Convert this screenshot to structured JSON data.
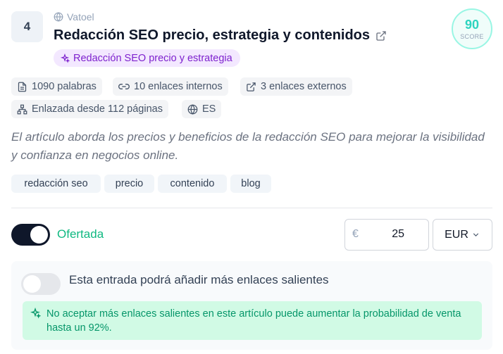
{
  "item": {
    "rank": "4",
    "site": "Vatoel",
    "title": "Redacción SEO precio, estrategia y contenidos",
    "keyword": "Redacción SEO precio y estrategia",
    "score": {
      "value": "90",
      "label": "SCORE"
    }
  },
  "stats": {
    "words": "1090 palabras",
    "internal_links": "10 enlaces internos",
    "external_links": "3 enlaces externos",
    "linked_from": "Enlazada desde 112 páginas",
    "language": "ES"
  },
  "description": "El artículo aborda los precios y beneficios de la redacción SEO para mejorar la visibilidad y confianza en negocios online.",
  "tags": [
    "redacción seo",
    "precio",
    "contenido",
    "blog"
  ],
  "offer": {
    "toggle_on": true,
    "label": "Ofertada",
    "currency_symbol": "€",
    "price": "25",
    "currency": "EUR"
  },
  "outbound": {
    "toggle_on": false,
    "label": "Esta entrada podrá añadir más enlaces salientes",
    "info": "No aceptar más enlaces salientes en este artículo puede aumentar la probabilidad de venta hasta un 92%."
  },
  "colors": {
    "accent_green": "#10b981",
    "score_teal": "#2dd4bf",
    "keyword_purple": "#7e22ce",
    "toggle_dark": "#0f172a"
  },
  "icons": [
    "globe-icon",
    "external-link-icon",
    "sparkles-icon",
    "document-icon",
    "link-icon",
    "sitemap-icon",
    "chevron-down-icon"
  ]
}
